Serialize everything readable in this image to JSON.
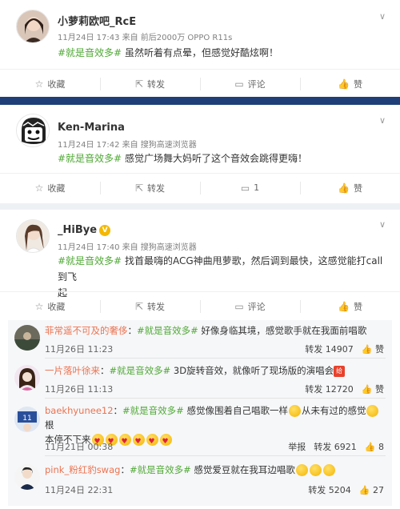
{
  "posts": [
    {
      "username": "小萝莉欧吧_RcE",
      "meta": "11月24日 17:43 来自 前后2000万 OPPO R11s",
      "hashtag": "#就是音效多#",
      "text": " 虽然听着有点晕，但感觉好酷炫啊！",
      "actions": {
        "favorite": "收藏",
        "repost": "转发",
        "comment": "评论",
        "like": "赞"
      }
    },
    {
      "username": "Ken-Marina",
      "meta": "11月24日 17:42 来自 搜狗高速浏览器",
      "hashtag": "#就是音效多#",
      "text": " 感觉广场舞大妈听了这个音效会跳得更嗨！",
      "actions": {
        "favorite": "收藏",
        "repost": "转发",
        "comment": "1",
        "like": "赞"
      }
    },
    {
      "username": "_HiBye",
      "meta": "11月24日 17:40 来自 搜狗高速浏览器",
      "hashtag": "#就是音效多#",
      "text": " 找首最嗨的ACG神曲甩萝歌，然后调到最快，这感觉能打call到飞",
      "text_line2": "起",
      "actions": {
        "favorite": "收藏",
        "repost": "转发",
        "comment": "评论",
        "like": "赞"
      }
    }
  ],
  "comments": [
    {
      "username": "菲常遥不可及的奢侈",
      "hashtag": "#就是音效多#",
      "text": " 好像身临其境，感觉歌手就在我面前唱歌",
      "date": "11月26日 11:23",
      "repost": "转发 14907",
      "like": "赞"
    },
    {
      "username": "一片落叶徐来",
      "hashtag": "#就是音效多#",
      "text": " 3D旋转音效，就像听了现场版的演唱会",
      "gift": "给",
      "date": "11月26日 11:13",
      "repost": "转发 12720",
      "like": "赞"
    },
    {
      "username": "baekhyunee12",
      "hashtag": "#就是音效多#",
      "text": " 感觉像围着自己唱歌一样",
      "text_b": "从未有过的感觉",
      "text_c": "根",
      "text_line2": "本停不下来",
      "date": "11月21日 00:38",
      "report": "举报",
      "repost": "转发 6921",
      "like": "8"
    },
    {
      "username": "pink_粉红豹swag",
      "hashtag": "#就是音效多#",
      "text": " 感觉爱豆就在我耳边唱歌",
      "date": "11月24日 22:31",
      "repost": "转发 5204",
      "like": "27"
    }
  ],
  "icons": {
    "favorite": "star-icon",
    "repost": "repost-icon",
    "comment": "comment-icon",
    "like": "thumbs-up-icon",
    "chevron": "chevron-down-icon"
  },
  "colors": {
    "hashtag": "#4fa835",
    "comment_username": "#eb7350",
    "separator": "#1e3f78"
  }
}
